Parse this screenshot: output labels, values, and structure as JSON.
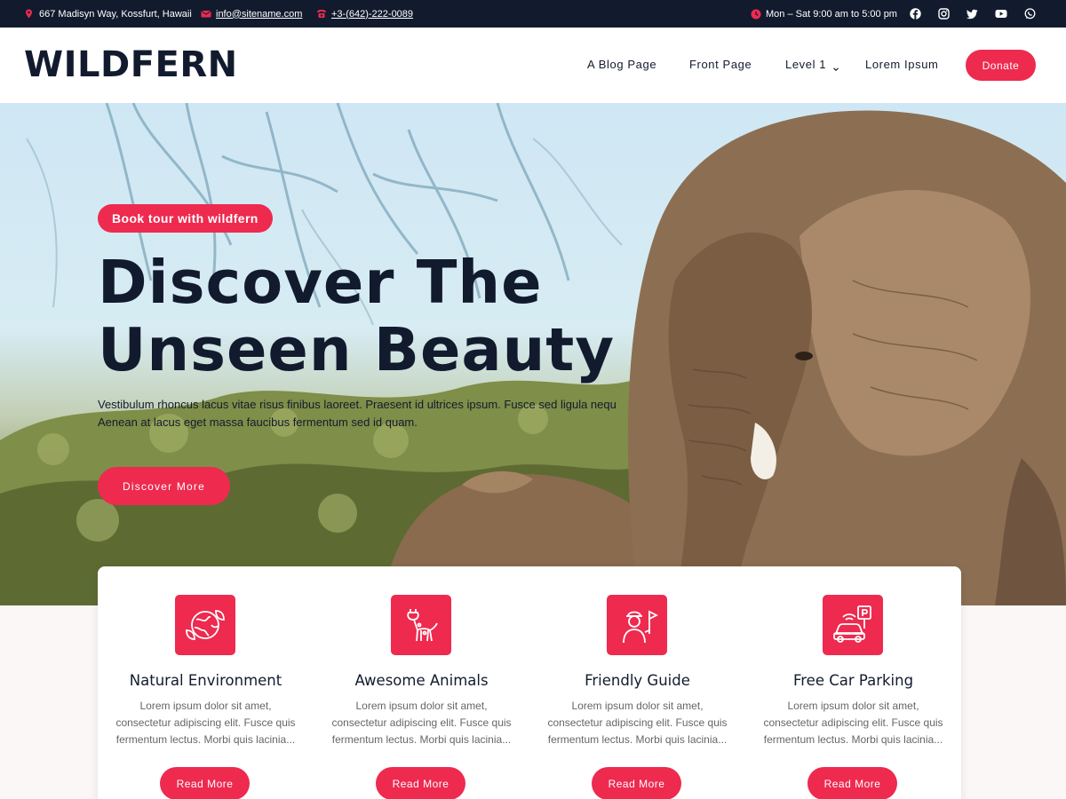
{
  "topbar": {
    "address": "667 Madisyn Way, Kossfurt, Hawaii",
    "email": "info@sitename.com",
    "phone": "+3-(642)-222-0089",
    "hours": "Mon – Sat 9:00 am to 5:00 pm",
    "social_icons": [
      "facebook-icon",
      "instagram-icon",
      "twitter-icon",
      "youtube-icon",
      "whatsapp-icon"
    ]
  },
  "header": {
    "logo": "WILDFERN",
    "nav": [
      "A Blog Page",
      "Front Page",
      "Level 1",
      "Lorem Ipsum"
    ],
    "donate_label": "Donate"
  },
  "hero": {
    "badge": "Book tour with wildfern",
    "title_line1": "Discover The",
    "title_line2": "Unseen Beauty",
    "text": "Vestibulum rhoncus lacus vitae risus finibus laoreet. Praesent id ultrices ipsum. Fusce sed ligula nequ Aenean at lacus eget massa faucibus fermentum sed id quam.",
    "button": "Discover More"
  },
  "features": [
    {
      "icon": "globe-leaf-icon",
      "title": "Natural Environment",
      "text": "Lorem ipsum dolor sit amet, consectetur adipiscing elit. Fusce quis fermentum lectus. Morbi quis lacinia...",
      "button": "Read More"
    },
    {
      "icon": "giraffe-icon",
      "title": "Awesome Animals",
      "text": "Lorem ipsum dolor sit amet, consectetur adipiscing elit. Fusce quis fermentum lectus. Morbi quis lacinia...",
      "button": "Read More"
    },
    {
      "icon": "guide-icon",
      "title": "Friendly Guide",
      "text": "Lorem ipsum dolor sit amet, consectetur adipiscing elit. Fusce quis fermentum lectus. Morbi quis lacinia...",
      "button": "Read More"
    },
    {
      "icon": "car-parking-icon",
      "title": "Free Car Parking",
      "text": "Lorem ipsum dolor sit amet, consectetur adipiscing elit. Fusce quis fermentum lectus. Morbi quis lacinia...",
      "button": "Read More"
    }
  ],
  "colors": {
    "accent": "#ee2a4f",
    "dark": "#121b2e",
    "body_text": "#666666"
  }
}
